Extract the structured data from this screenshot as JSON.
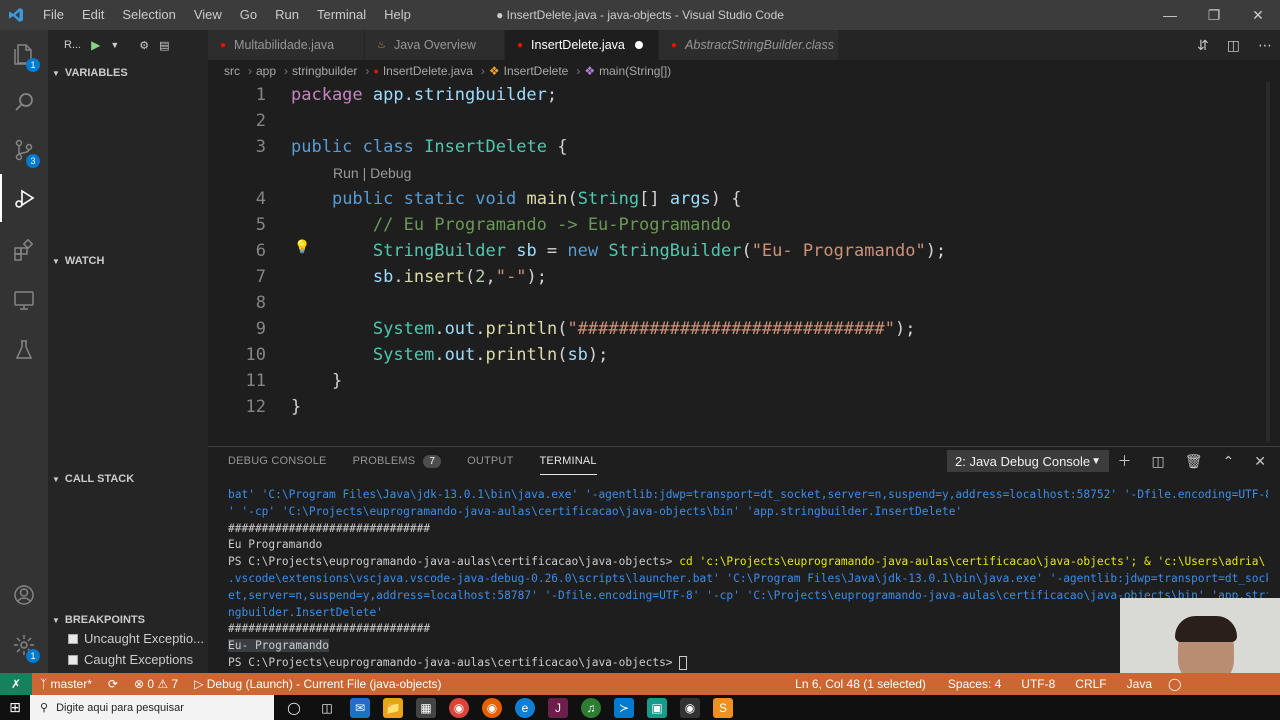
{
  "window": {
    "title": "● InsertDelete.java - java-objects - Visual Studio Code",
    "logo": "vs-code-logo",
    "controls": [
      "minimize",
      "maximize",
      "close"
    ]
  },
  "menu": [
    "File",
    "Edit",
    "Selection",
    "View",
    "Go",
    "Run",
    "Terminal",
    "Help"
  ],
  "activity": {
    "items": [
      {
        "name": "explorer",
        "badge": "1"
      },
      {
        "name": "search",
        "badge": ""
      },
      {
        "name": "source-control",
        "badge": "3"
      },
      {
        "name": "run-debug",
        "badge": ""
      },
      {
        "name": "extensions",
        "badge": ""
      },
      {
        "name": "remote-explorer",
        "badge": ""
      },
      {
        "name": "testing",
        "badge": ""
      }
    ],
    "account_badge": "",
    "settings_badge": "1"
  },
  "sidebar": {
    "run_label": "R...",
    "variables": "VARIABLES",
    "watch": "WATCH",
    "call_stack": "CALL STACK",
    "breakpoints": "BREAKPOINTS",
    "bp_items": [
      "Uncaught Exceptio...",
      "Caught Exceptions"
    ]
  },
  "tabs": [
    {
      "label": "Multabilidade.java",
      "icon": "●",
      "icon_color": "#e51400",
      "active": false,
      "italic": false,
      "dirty": false
    },
    {
      "label": "Java Overview",
      "icon": "♨",
      "icon_color": "#c09553",
      "active": false,
      "italic": false,
      "dirty": false
    },
    {
      "label": "InsertDelete.java",
      "icon": "●",
      "icon_color": "#e51400",
      "active": true,
      "italic": false,
      "dirty": true
    },
    {
      "label": "AbstractStringBuilder.class",
      "icon": "●",
      "icon_color": "#e51400",
      "active": false,
      "italic": true,
      "dirty": false
    }
  ],
  "breadcrumb": [
    "src",
    "app",
    "stringbuilder",
    "InsertDelete.java",
    "InsertDelete",
    "main(String[])"
  ],
  "codelens": "Run | Debug",
  "code": {
    "line_numbers": [
      "1",
      "2",
      "3",
      "4",
      "5",
      "6",
      "7",
      "8",
      "9",
      "10",
      "11",
      "12"
    ],
    "l1": {
      "kw": "package",
      "pkg": "app.stringbuilder",
      "end": ";"
    },
    "l3": {
      "kw1": "public",
      "kw2": "class",
      "name": "InsertDelete",
      "brace": "{"
    },
    "l4": {
      "kw1": "public",
      "kw2": "static",
      "kw3": "void",
      "fn": "main",
      "p1": "(",
      "ty": "String",
      "p2": "[] ",
      "arg": "args",
      "p3": ") {"
    },
    "l5": "// Eu Programando -> Eu-Programando",
    "l6": {
      "ty": "StringBuilder",
      "var": "sb",
      "eq": " = ",
      "kw": "new",
      "ctor": "StringBuilder",
      "p1": "(",
      "str": "\"Eu- Programando\"",
      "p2": ");"
    },
    "l7": {
      "var": "sb",
      "dot": ".",
      "fn": "insert",
      "p1": "(",
      "num": "2",
      "comma": ",",
      "str": "\"-\"",
      "p2": ");"
    },
    "l9": {
      "cls": "System",
      "dot1": ".",
      "field": "out",
      "dot2": ".",
      "fn": "println",
      "p1": "(",
      "str": "\"##############################\"",
      "p2": ");"
    },
    "l10": {
      "cls": "System",
      "dot1": ".",
      "field": "out",
      "dot2": ".",
      "fn": "println",
      "p1": "(",
      "arg": "sb",
      "p2": ");"
    },
    "l11": "}",
    "l12": "}"
  },
  "panel": {
    "tabs": [
      "DEBUG CONSOLE",
      "PROBLEMS",
      "OUTPUT",
      "TERMINAL"
    ],
    "problems_count": "7",
    "console_select": "2: Java Debug Console",
    "terminal_lines": [
      "bat' 'C:\\Program Files\\Java\\jdk-13.0.1\\bin\\java.exe' '-agentlib:jdwp=transport=dt_socket,server=n,suspend=y,address=localhost:58752' '-Dfile.encoding=UTF-8",
      "' '-cp' 'C:\\Projects\\euprogramando-java-aulas\\certificacao\\java-objects\\bin' 'app.stringbuilder.InsertDelete'",
      "##############################",
      "Eu Programando",
      "PS C:\\Projects\\euprogramando-java-aulas\\certificacao\\java-objects>",
      " cd 'c:\\Projects\\euprogramando-java-aulas\\certificacao\\java-objects'; & 'c:\\Users\\adria\\",
      ".vscode\\extensions\\vscjava.vscode-java-debug-0.26.0\\scripts\\launcher.bat' 'C:\\Program Files\\Java\\jdk-13.0.1\\bin\\java.exe' '-agentlib:jdwp=transport=dt_sock",
      "et,server=n,suspend=y,address=localhost:58787' '-Dfile.encoding=UTF-8' '-cp' 'C:\\Projects\\euprogramando-java-aulas\\certificacao\\java-objects\\bin' 'app.stri",
      "ngbuilder.InsertDelete'",
      "##############################",
      "Eu- Programando",
      "PS C:\\Projects\\euprogramando-java-aulas\\certificacao\\java-objects> "
    ]
  },
  "status": {
    "branch": "master*",
    "errors": "0",
    "warnings": "7",
    "debug": "Debug (Launch) - Current File (java-objects)",
    "position": "Ln 6, Col 48 (1 selected)",
    "spaces": "Spaces: 4",
    "encoding": "UTF-8",
    "eol": "CRLF",
    "language": "Java",
    "color": "#cc6633"
  },
  "taskbar": {
    "search_placeholder": "Digite aqui para pesquisar"
  }
}
